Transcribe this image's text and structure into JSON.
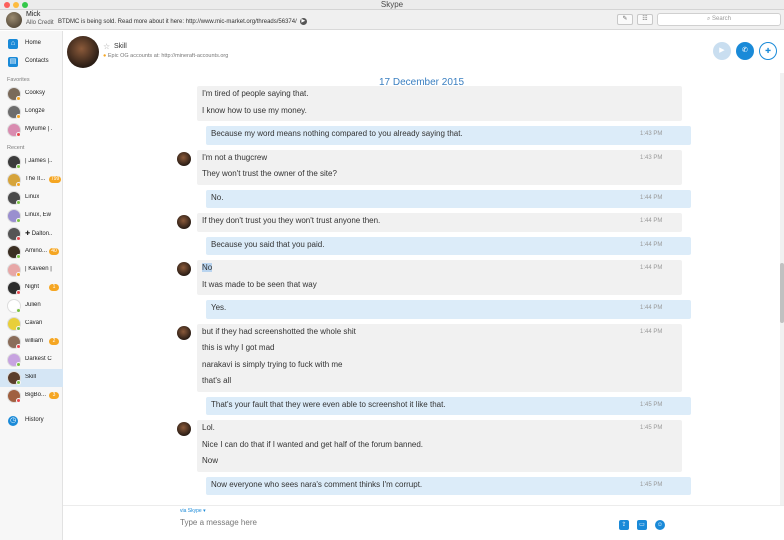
{
  "window": {
    "title": "Skype"
  },
  "me": {
    "name": "Mick",
    "credit": "Allo Credit",
    "mood": "BTDMC is being sold. Read more about it here: http://www.mic-market.org/threads/56374/"
  },
  "toolbar": {
    "search_placeholder": "Search",
    "btn_compose": "✎",
    "btn_dial": "☷"
  },
  "nav": {
    "home": "Home",
    "contacts": "Contacts",
    "history": "History"
  },
  "sidebar": {
    "favorites_label": "Favorites",
    "recent_label": "Recent",
    "favorites": [
      {
        "name": "Cooksy",
        "color": "#7a6a5a",
        "status": "#f5a623"
      },
      {
        "name": "Longze",
        "color": "#6d6d6d",
        "status": "#f5a623"
      },
      {
        "name": "Mylume | ...",
        "color": "#d98cb0",
        "status": "#e5484d"
      }
    ],
    "recent": [
      {
        "name": "| James |...",
        "color": "#3c3c3c",
        "status": "#7bc043",
        "badge": ""
      },
      {
        "name": "The II...",
        "color": "#d6a43b",
        "status": "#f5a623",
        "badge": "799"
      },
      {
        "name": "Linux",
        "color": "#4a4a4a",
        "status": "#7bc043",
        "badge": ""
      },
      {
        "name": "Linux, Ew",
        "color": "#9a8fcf",
        "status": "#7bc043",
        "badge": ""
      },
      {
        "name": "✚ Dalton...",
        "color": "#555555",
        "status": "#e5484d",
        "badge": ""
      },
      {
        "name": "Amino...",
        "color": "#3a2e22",
        "status": "#7bc043",
        "badge": "40"
      },
      {
        "name": "| Kaveen |...",
        "color": "#e7a7a7",
        "status": "#f5a623",
        "badge": ""
      },
      {
        "name": "Night",
        "color": "#2d2d2d",
        "status": "#e5484d",
        "badge": "1"
      },
      {
        "name": "Julien",
        "color": "#ffffff",
        "status": "#7bc043",
        "badge": ""
      },
      {
        "name": "Cavan",
        "color": "#e8cf3a",
        "status": "#7bc043",
        "badge": ""
      },
      {
        "name": "william",
        "color": "#8a6d5a",
        "status": "#e5484d",
        "badge": "2"
      },
      {
        "name": "Darkest C...",
        "color": "#c7a3e0",
        "status": "#7bc043",
        "badge": ""
      },
      {
        "name": "Skill",
        "color": "#5a3d2b",
        "status": "#7bc043",
        "badge": ""
      },
      {
        "name": "BigBo...",
        "color": "#a06040",
        "status": "#e5484d",
        "badge": "3"
      }
    ]
  },
  "conversation": {
    "name": "Skill",
    "status": "Epic OG accounts at: http://mineraft-accounts.org",
    "date": "17 December 2015"
  },
  "messages": [
    {
      "dir": "in",
      "avatar": false,
      "lines": [
        "I'm tired of people saying that.",
        "I know how to use my money."
      ],
      "time": ""
    },
    {
      "dir": "out",
      "lines": [
        "Because my word means nothing compared to you already saying that."
      ],
      "time": "1:43 PM"
    },
    {
      "dir": "in",
      "avatar": true,
      "lines": [
        "I'm not a thugcrew",
        "They won't trust the owner of the site?"
      ],
      "time": "1:43 PM"
    },
    {
      "dir": "out",
      "lines": [
        "No."
      ],
      "time": "1:44 PM"
    },
    {
      "dir": "in",
      "avatar": true,
      "lines": [
        "If they don't trust you they won't trust anyone then."
      ],
      "time": "1:44 PM"
    },
    {
      "dir": "out",
      "lines": [
        "Because you said that you paid."
      ],
      "time": "1:44 PM"
    },
    {
      "dir": "in",
      "avatar": true,
      "lines": [
        "No",
        "It was made to be seen that way"
      ],
      "time": "1:44 PM"
    },
    {
      "dir": "out",
      "lines": [
        "Yes."
      ],
      "time": "1:44 PM"
    },
    {
      "dir": "in",
      "avatar": true,
      "lines": [
        "but if they had screenshotted the whole shit",
        "this is why I got mad",
        "narakavi is simply trying to fuck with me",
        "that's all"
      ],
      "time": "1:44 PM"
    },
    {
      "dir": "out",
      "lines": [
        "That's your fault that they were even able to screenshot it like that."
      ],
      "time": "1:45 PM"
    },
    {
      "dir": "in",
      "avatar": true,
      "lines": [
        "Lol.",
        "Nice I can do that if I wanted and get half of the forum banned.",
        "Now"
      ],
      "time": "1:45 PM"
    },
    {
      "dir": "out",
      "lines": [
        "Now everyone who sees nara's comment thinks I'm corrupt."
      ],
      "time": "1:45 PM"
    }
  ],
  "composer": {
    "via_prefix": "via",
    "via_service": "Skype ▾",
    "placeholder": "Type a message here"
  },
  "colors": {
    "accent": "#1a8ad8",
    "out_bubble": "#dcecf9",
    "in_bubble": "#f1f1f1"
  }
}
